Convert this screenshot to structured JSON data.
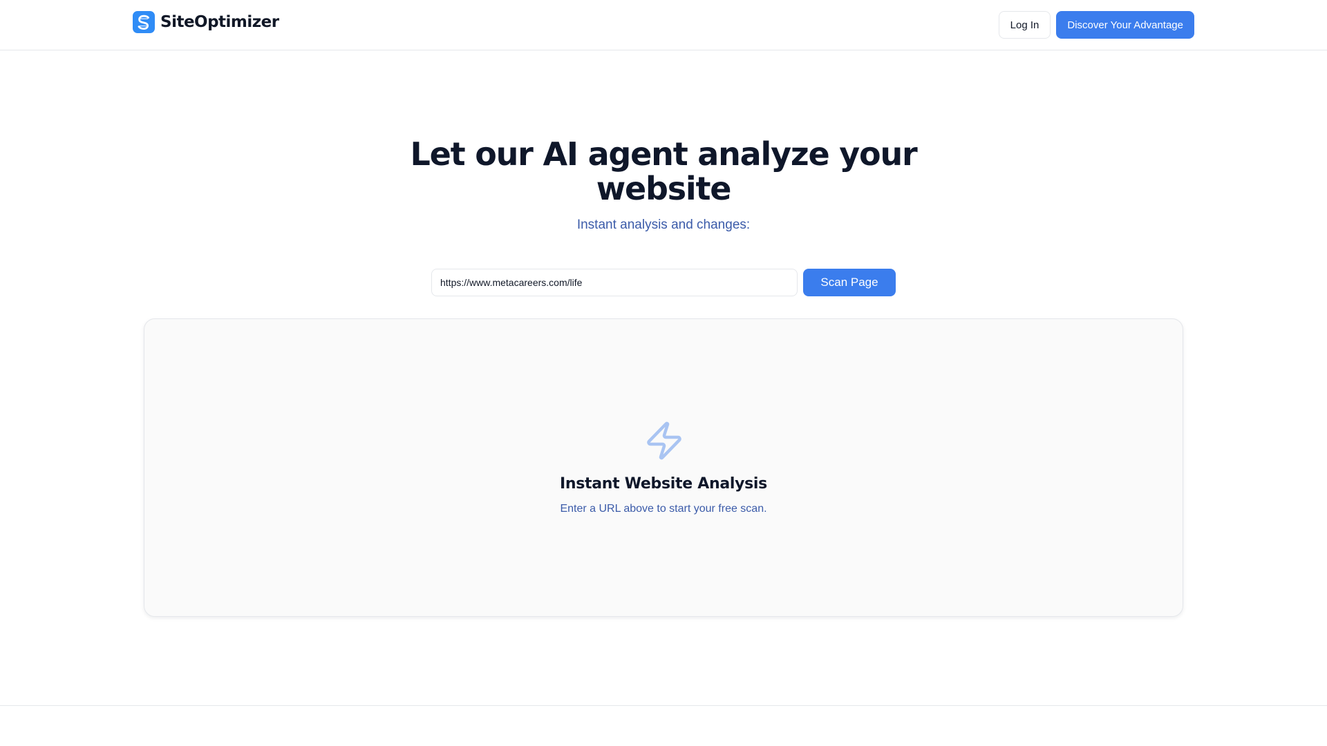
{
  "header": {
    "brand_name": "SiteOptimizer",
    "login_label": "Log In",
    "cta_label": "Discover Your Advantage"
  },
  "hero": {
    "title": "Let our AI agent analyze your website",
    "subtitle": "Instant analysis and changes:"
  },
  "scan": {
    "url_value": "https://www.metacareers.com/life",
    "button_label": "Scan Page"
  },
  "panel": {
    "icon": "lightning-bolt-icon",
    "title": "Instant Website Analysis",
    "subtitle": "Enter a URL above to start your free scan."
  },
  "colors": {
    "accent": "#3b7ded",
    "logo": "#2f8cf6",
    "subtext": "#3b5ba9",
    "heading": "#0f172a"
  }
}
